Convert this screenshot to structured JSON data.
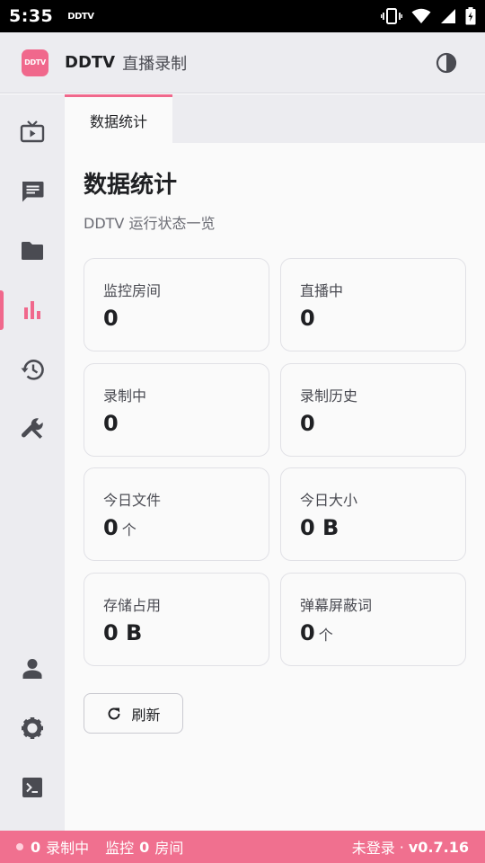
{
  "status_bar": {
    "time": "5:35",
    "notification": "DDTV"
  },
  "header": {
    "logo_text": "DDTV",
    "app_name": "DDTV",
    "app_subtitle": "直播录制",
    "theme_icon": "contrast-icon"
  },
  "sidebar": {
    "items": [
      {
        "icon": "live-tv-icon",
        "active": false
      },
      {
        "icon": "chat-icon",
        "active": false
      },
      {
        "icon": "folder-icon",
        "active": false
      },
      {
        "icon": "bar-chart-icon",
        "active": true
      },
      {
        "icon": "history-icon",
        "active": false
      },
      {
        "icon": "wrench-icon",
        "active": false
      },
      {
        "icon": "user-icon",
        "active": false
      },
      {
        "icon": "gear-icon",
        "active": false
      },
      {
        "icon": "terminal-icon",
        "active": false
      }
    ]
  },
  "tabs": [
    {
      "label": "数据统计",
      "active": true
    }
  ],
  "page": {
    "title": "数据统计",
    "subtitle": "DDTV 运行状态一览"
  },
  "stats": [
    {
      "label": "监控房间",
      "value": "0",
      "unit": ""
    },
    {
      "label": "直播中",
      "value": "0",
      "unit": ""
    },
    {
      "label": "录制中",
      "value": "0",
      "unit": ""
    },
    {
      "label": "录制历史",
      "value": "0",
      "unit": ""
    },
    {
      "label": "今日文件",
      "value": "0",
      "unit": "个"
    },
    {
      "label": "今日大小",
      "value": "0 B",
      "unit": ""
    },
    {
      "label": "存储占用",
      "value": "0 B",
      "unit": ""
    },
    {
      "label": "弹幕屏蔽词",
      "value": "0",
      "unit": "个"
    }
  ],
  "refresh_button": {
    "label": "刷新"
  },
  "footer": {
    "recording_count": "0",
    "recording_label": "录制中",
    "monitor_prefix": "监控",
    "monitor_count": "0",
    "monitor_suffix": "房间",
    "login_status": "未登录",
    "version": "v0.7.16"
  },
  "colors": {
    "accent": "#f0688c",
    "footer_bg": "#f0708f",
    "sidebar_bg": "#ececf0",
    "icon": "#4a4b52"
  }
}
